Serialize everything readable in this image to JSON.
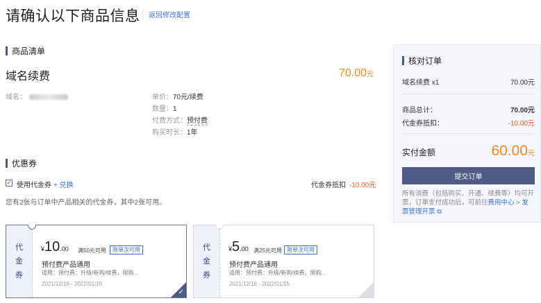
{
  "header": {
    "title": "请确认以下商品信息",
    "back_label": "返回修改配置"
  },
  "product_section": {
    "heading": "商品清单",
    "name": "域名续费",
    "price": "70.00",
    "price_unit": "元",
    "domain_label": "域名：",
    "details": [
      {
        "label": "单价：",
        "value": "70元/续费"
      },
      {
        "label": "数量：",
        "value": "1"
      },
      {
        "label": "付费方式：",
        "value": "预付费"
      },
      {
        "label": "购买时长：",
        "value": "1年"
      }
    ]
  },
  "coupon_section": {
    "heading": "优惠券",
    "use_label": "使用代金券",
    "exchange_label": "+ 兑换",
    "deduct_label": "代金券抵扣",
    "deduct_value": "-10.00元",
    "hint": "您有2张与订单中产品相关的代金券，其中2张可用。",
    "coupons": [
      {
        "side_label": [
          "代",
          "金",
          "券"
        ],
        "yen": "¥",
        "amount": "10",
        "decimal": ".00",
        "condition": "满50元可用",
        "tag": "限单次可用",
        "title": "预付费产品通用",
        "scope": "适用：预付费：升级/新购/续费，限购...",
        "dates": "2021/12/16 - 2022/01/15",
        "selected": true
      },
      {
        "side_label": [
          "代",
          "金",
          "券"
        ],
        "yen": "¥",
        "amount": "5",
        "decimal": ".00",
        "condition": "满25元可用",
        "tag": "限单次可用",
        "title": "预付费产品通用",
        "scope": "适用：预付费：升级/新购/续费，限购...",
        "dates": "2021/12/16 - 2022/01/15",
        "selected": false
      }
    ]
  },
  "summary": {
    "heading": "核对订单",
    "item_label": "域名续费 x1",
    "item_value": "70.00元",
    "total_label": "商品总计：",
    "total_value": "70.00元",
    "coupon_label": "代金券抵扣：",
    "coupon_value": "-10.00元",
    "pay_label": "实付金额",
    "pay_value": "60.00",
    "pay_unit": "元",
    "submit_label": "提交订单",
    "note_text": "所有消费（包括购买、开通、续费等）均可开票，订单支付成功后，可前往",
    "note_link": "费用中心 > 发票管理开票"
  },
  "colors": {
    "accent": "#4e5b86",
    "price": "#f08a1e",
    "discount": "#f2551e",
    "link": "#3b6fd6"
  }
}
